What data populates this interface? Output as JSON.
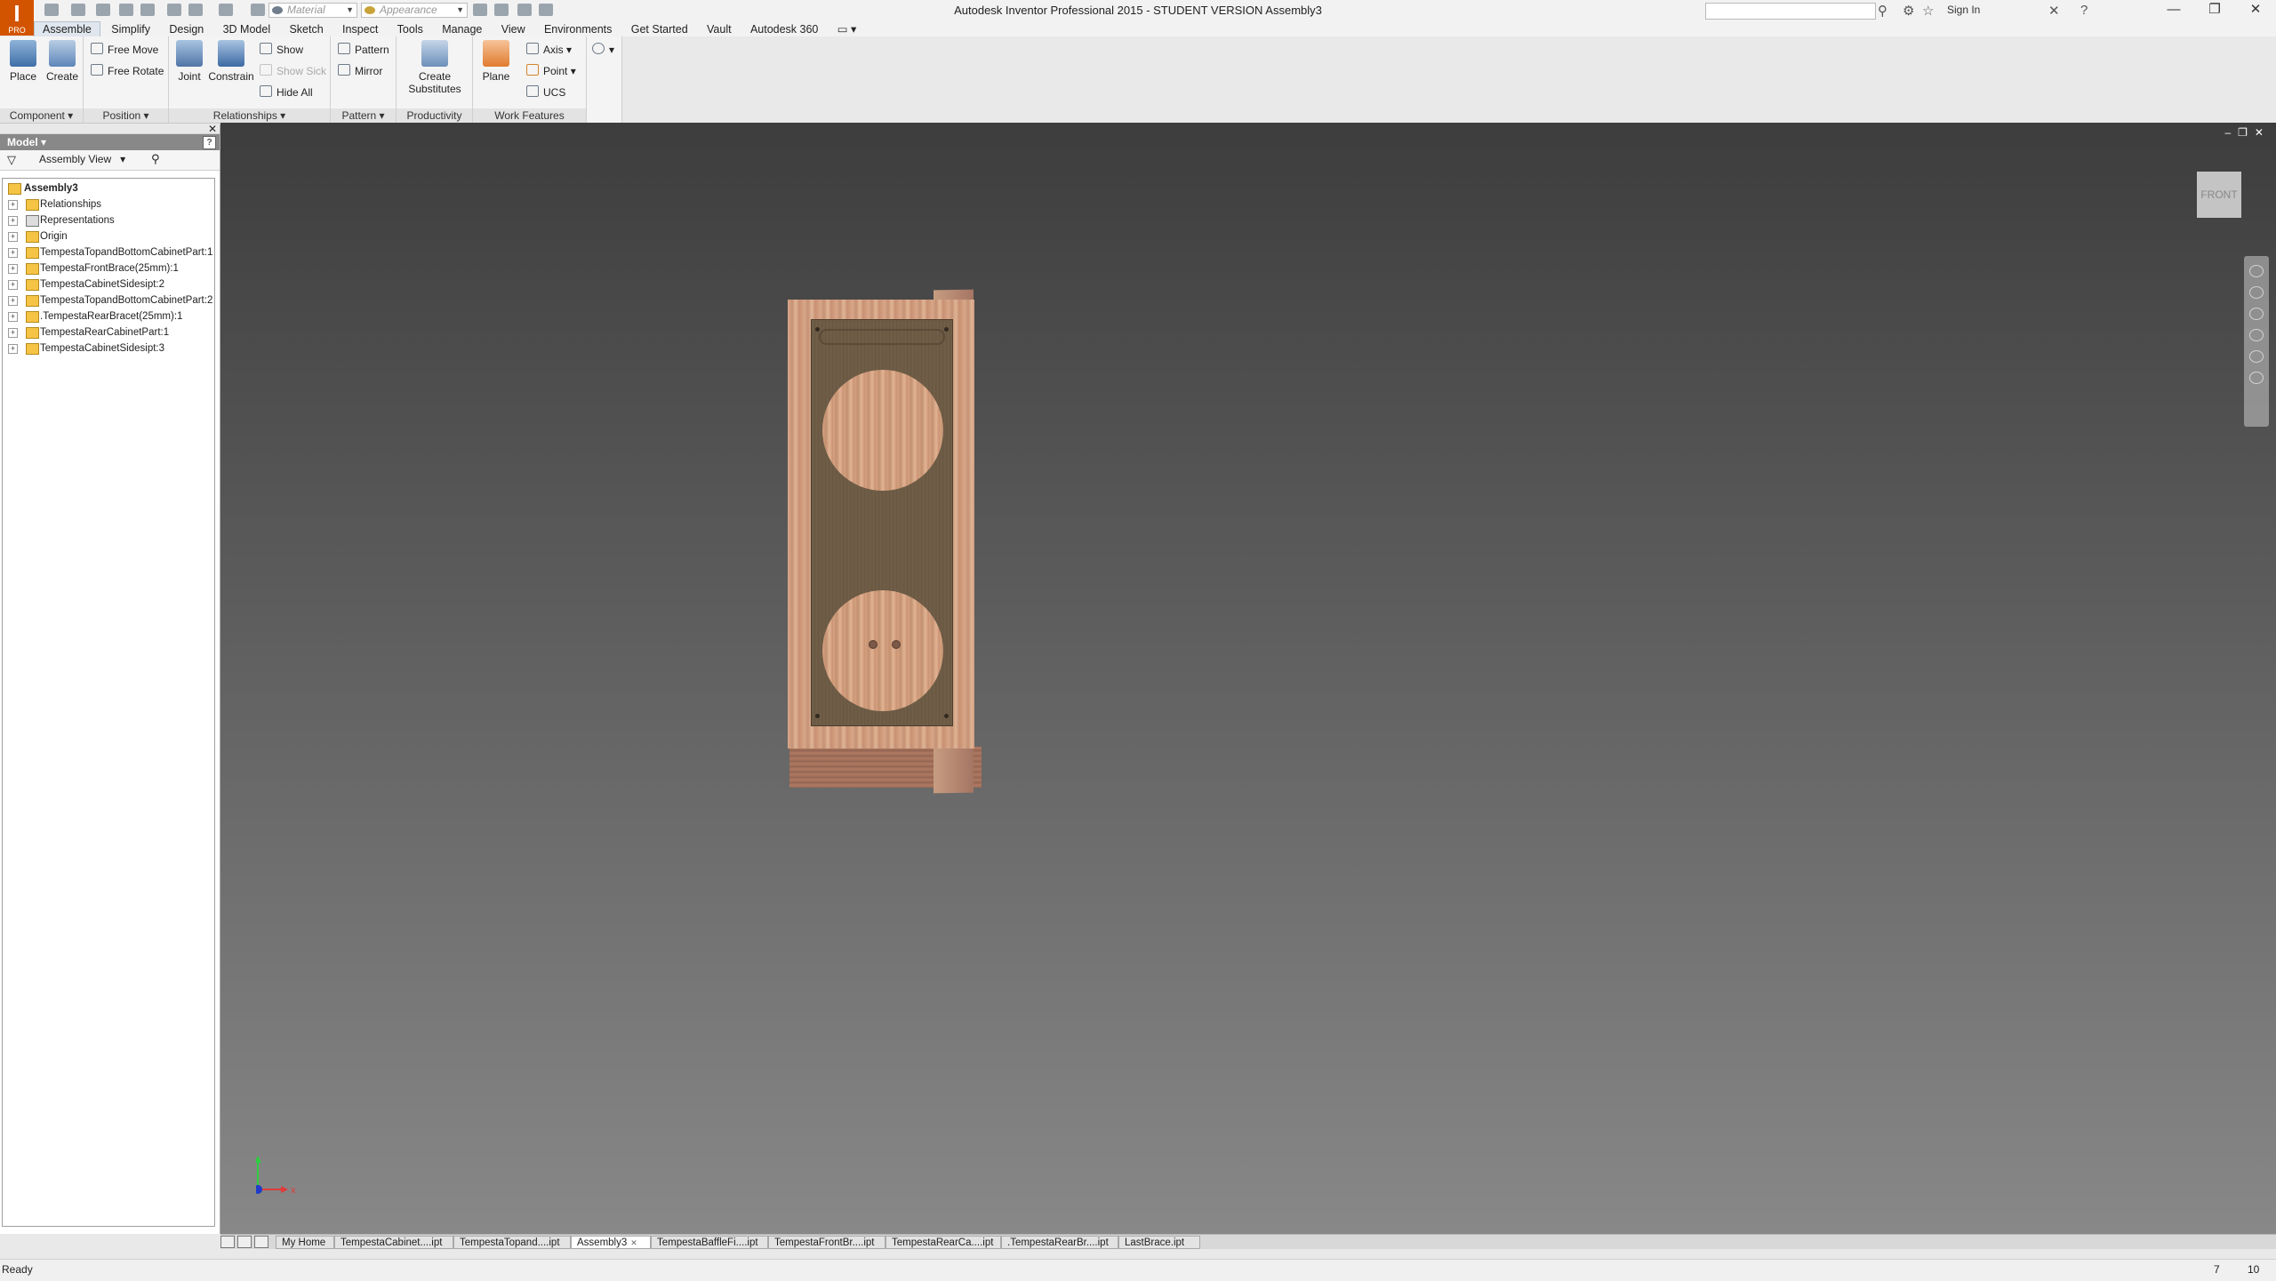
{
  "app": {
    "window_title": "Autodesk Inventor Professional 2015 - STUDENT VERSION    Assembly3",
    "app_button_label": "PRO",
    "material_placeholder": "Material",
    "appearance_placeholder": "Appearance",
    "sign_in": "Sign In"
  },
  "ribbon": {
    "tabs": [
      "Assemble",
      "Simplify",
      "Design",
      "3D Model",
      "Sketch",
      "Inspect",
      "Tools",
      "Manage",
      "View",
      "Environments",
      "Get Started",
      "Vault",
      "Autodesk 360"
    ],
    "active_tab": "Assemble",
    "component": {
      "label": "Component",
      "place": "Place",
      "create": "Create"
    },
    "position": {
      "label": "Position",
      "free_move": "Free Move",
      "free_rotate": "Free Rotate"
    },
    "relationships": {
      "label": "Relationships",
      "joint": "Joint",
      "constrain": "Constrain",
      "show": "Show",
      "show_sick": "Show Sick",
      "hide_all": "Hide All"
    },
    "pattern": {
      "label": "Pattern",
      "pattern": "Pattern",
      "mirror": "Mirror"
    },
    "productivity": {
      "label": "Productivity",
      "create": "Create",
      "substitutes": "Substitutes"
    },
    "work_features": {
      "label": "Work Features",
      "plane": "Plane",
      "axis": "Axis",
      "point": "Point",
      "ucs": "UCS"
    }
  },
  "browser": {
    "title": "Model",
    "view": "Assembly View",
    "root": "Assembly3",
    "items": [
      "Relationships",
      "Representations",
      "Origin",
      "TempestaTopandBottomCabinetPart:1",
      "TempestaFrontBrace(25mm):1",
      "TempestaCabinetSidesipt:2",
      "TempestaTopandBottomCabinetPart:2",
      ".TempestaRearBracet(25mm):1",
      "TempestaRearCabinetPart:1",
      "TempestaCabinetSidesipt:3"
    ]
  },
  "viewport": {
    "viewcube_face": "FRONT",
    "triad_x": "x"
  },
  "document_tabs": [
    {
      "label": "My Home",
      "active": false
    },
    {
      "label": "TempestaCabinet....ipt",
      "active": false
    },
    {
      "label": "TempestaTopand....ipt",
      "active": false
    },
    {
      "label": "Assembly3",
      "active": true
    },
    {
      "label": "TempestaBaffleFi....ipt",
      "active": false
    },
    {
      "label": "TempestaFrontBr....ipt",
      "active": false
    },
    {
      "label": "TempestaRearCa....ipt",
      "active": false
    },
    {
      "label": ".TempestaRearBr....ipt",
      "active": false
    },
    {
      "label": "LastBrace.ipt",
      "active": false
    }
  ],
  "status": {
    "text": "Ready",
    "count1": "7",
    "count2": "10"
  },
  "colors": {
    "app_orange": "#d35400",
    "viewport_top": "#3d3d3d",
    "viewport_bottom": "#888888",
    "baffle": "#6b5a45",
    "wood": "#d8a98a"
  }
}
